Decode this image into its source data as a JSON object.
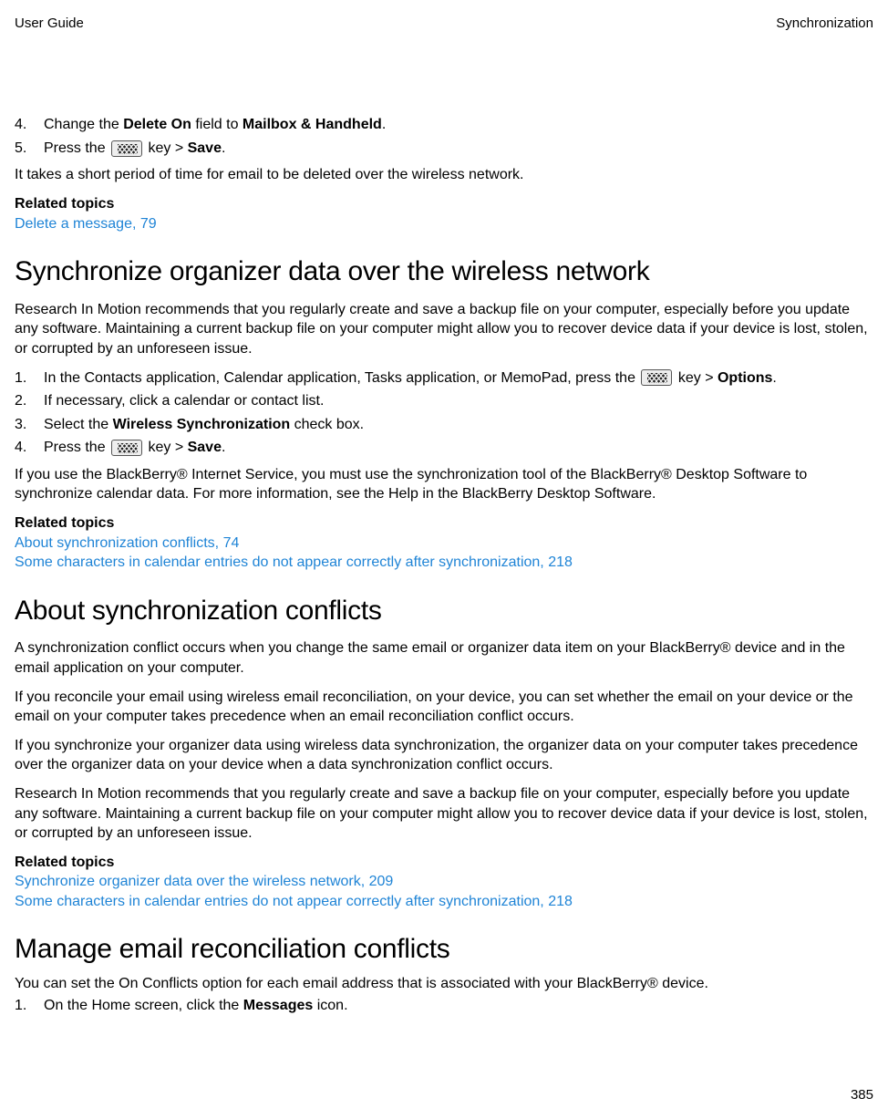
{
  "header": {
    "left": "User Guide",
    "right": "Synchronization"
  },
  "sec0": {
    "step4": {
      "num": "4.",
      "a": "Change the ",
      "b": "Delete On",
      "c": " field to ",
      "d": "Mailbox & Handheld",
      "e": "."
    },
    "step5": {
      "num": "5.",
      "a": "Press the ",
      "b": " key > ",
      "c": "Save",
      "d": "."
    },
    "p1": "It takes a short period of time for email to be deleted over the wireless network.",
    "rt": "Related topics",
    "link1": "Delete a message, 79"
  },
  "sec1": {
    "h": "Synchronize organizer data over the wireless network",
    "p1": "Research In Motion recommends that you regularly create and save a backup file on your computer, especially before you update any software. Maintaining a current backup file on your computer might allow you to recover device data if your device is lost, stolen, or corrupted by an unforeseen issue.",
    "step1": {
      "num": "1.",
      "a": "In the Contacts application, Calendar application, Tasks application, or MemoPad, press the ",
      "b": " key > ",
      "c": "Options",
      "d": "."
    },
    "step2": {
      "num": "2.",
      "a": "If necessary, click a calendar or contact list."
    },
    "step3": {
      "num": "3.",
      "a": "Select the ",
      "b": "Wireless Synchronization",
      "c": " check box."
    },
    "step4": {
      "num": "4.",
      "a": "Press the ",
      "b": " key > ",
      "c": "Save",
      "d": "."
    },
    "p2": "If you use the BlackBerry® Internet Service, you must use the synchronization tool of the BlackBerry® Desktop Software to synchronize calendar data. For more information, see the Help in the BlackBerry Desktop Software.",
    "rt": "Related topics",
    "link1": "About synchronization conflicts, 74",
    "link2": "Some characters in calendar entries do not appear correctly after synchronization, 218"
  },
  "sec2": {
    "h": "About synchronization conflicts",
    "p1": "A synchronization conflict occurs when you change the same email or organizer data item on your BlackBerry® device and in the email application on your computer.",
    "p2": "If you reconcile your email using wireless email reconciliation, on your device, you can set whether the email on your device or the email on your computer takes precedence when an email reconciliation conflict occurs.",
    "p3": "If you synchronize your organizer data using wireless data synchronization, the organizer data on your computer takes precedence over the organizer data on your device when a data synchronization conflict occurs.",
    "p4": "Research In Motion recommends that you regularly create and save a backup file on your computer, especially before you update any software. Maintaining a current backup file on your computer might allow you to recover device data if your device is lost, stolen, or corrupted by an unforeseen issue.",
    "rt": "Related topics",
    "link1": "Synchronize organizer data over the wireless network, 209",
    "link2": "Some characters in calendar entries do not appear correctly after synchronization, 218"
  },
  "sec3": {
    "h": "Manage email reconciliation conflicts",
    "p1": "You can set the On Conflicts option for each email address that is associated with your BlackBerry® device.",
    "step1": {
      "num": "1.",
      "a": "On the Home screen, click the ",
      "b": "Messages",
      "c": " icon."
    }
  },
  "footer": {
    "page": "385"
  }
}
